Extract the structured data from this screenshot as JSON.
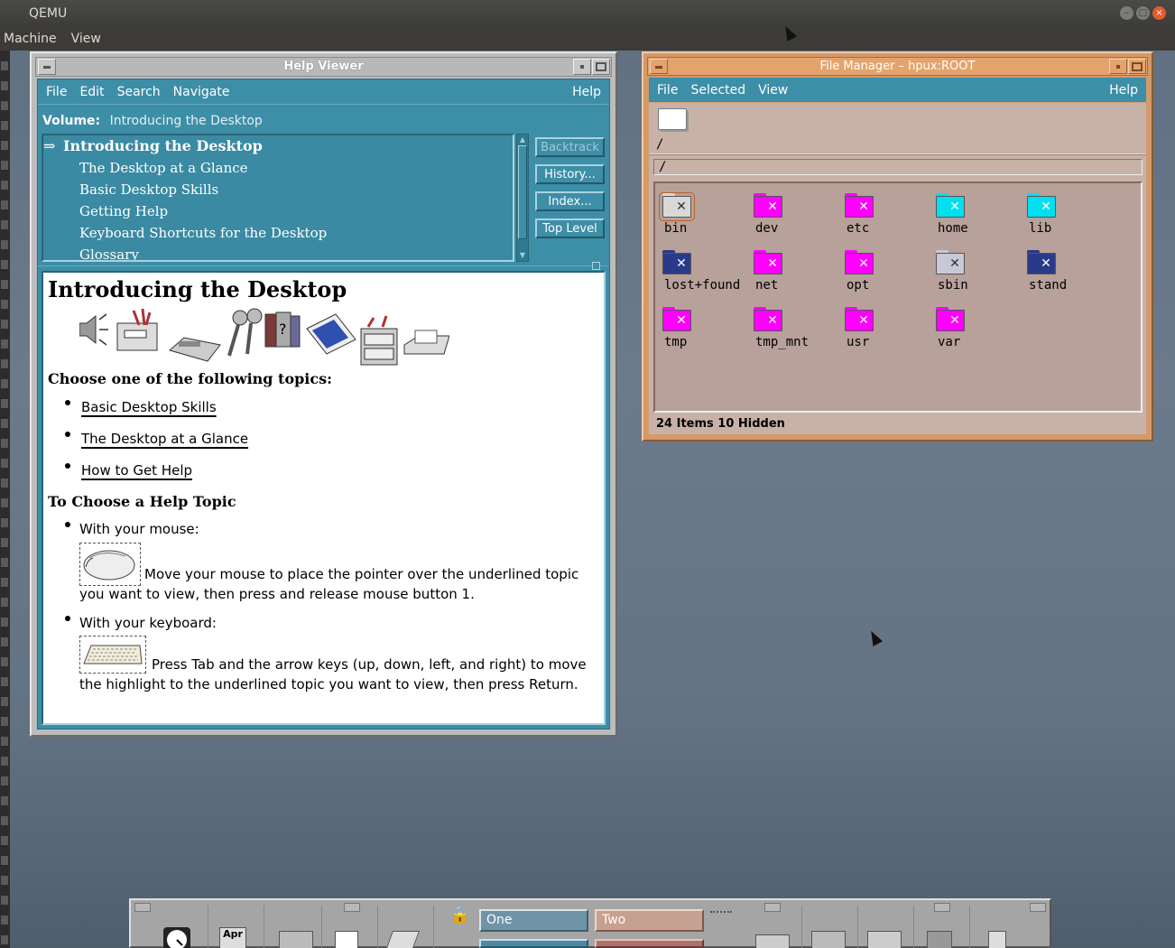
{
  "host": {
    "title": "QEMU",
    "menu": [
      "Machine",
      "View"
    ]
  },
  "help_viewer": {
    "title": "Help Viewer",
    "menu": [
      "File",
      "Edit",
      "Search",
      "Navigate"
    ],
    "menu_help": "Help",
    "volume_label": "Volume:",
    "volume_value": "Introducing the Desktop",
    "topics": [
      "Introducing the Desktop",
      "The Desktop at a Glance",
      "Basic Desktop Skills",
      "Getting Help",
      "Keyboard Shortcuts for the Desktop",
      "Glossary"
    ],
    "topic_arrow": "⇒",
    "buttons": {
      "backtrack": "Backtrack",
      "history": "History...",
      "index": "Index...",
      "top_level": "Top Level"
    },
    "content": {
      "heading": "Introducing the Desktop",
      "subheading1": "Choose one of the following topics:",
      "links": [
        "Basic Desktop Skills",
        "The Desktop at a Glance",
        "How to Get Help"
      ],
      "subheading2": "To Choose a Help Topic",
      "mouse_label": "With your mouse:",
      "mouse_text": "Move your mouse to place the pointer over the underlined topic you want to view, then press and release mouse button 1.",
      "keyboard_label": "With your keyboard:",
      "keyboard_text": "Press Tab and the arrow keys (up, down, left, and right) to move the highlight to the underlined topic you want to view, then press Return."
    }
  },
  "file_manager": {
    "title": "File Manager – hpux:ROOT",
    "menu": [
      "File",
      "Selected",
      "View"
    ],
    "menu_help": "Help",
    "path_display": "/",
    "path_field": "/",
    "items": [
      {
        "name": "bin",
        "color": "#d8d8d8",
        "icon": "folder-bin-icon"
      },
      {
        "name": "dev",
        "color": "#ff00ff",
        "icon": "folder-dev-icon"
      },
      {
        "name": "etc",
        "color": "#ff00ff",
        "icon": "folder-etc-icon"
      },
      {
        "name": "home",
        "color": "#00e0f0",
        "icon": "folder-home-icon"
      },
      {
        "name": "lib",
        "color": "#00e0f0",
        "icon": "folder-lib-icon"
      },
      {
        "name": "lost+found",
        "color": "#2a3a8a",
        "icon": "folder-lost-found-icon"
      },
      {
        "name": "net",
        "color": "#ff00ff",
        "icon": "folder-net-icon"
      },
      {
        "name": "opt",
        "color": "#ff00ff",
        "icon": "folder-opt-icon"
      },
      {
        "name": "sbin",
        "color": "#c8c8d8",
        "icon": "folder-sbin-icon"
      },
      {
        "name": "stand",
        "color": "#2a3a8a",
        "icon": "folder-stand-icon"
      },
      {
        "name": "tmp",
        "color": "#ff00ff",
        "icon": "folder-tmp-icon"
      },
      {
        "name": "tmp_mnt",
        "color": "#ff00ff",
        "icon": "folder-tmp-mnt-icon"
      },
      {
        "name": "usr",
        "color": "#ff00ff",
        "icon": "folder-usr-icon"
      },
      {
        "name": "var",
        "color": "#ff00ff",
        "icon": "folder-var-icon"
      }
    ],
    "status": "24 Items 10 Hidden"
  },
  "front_panel": {
    "workspaces": [
      "One",
      "Two"
    ],
    "calendar_month": "Apr"
  }
}
